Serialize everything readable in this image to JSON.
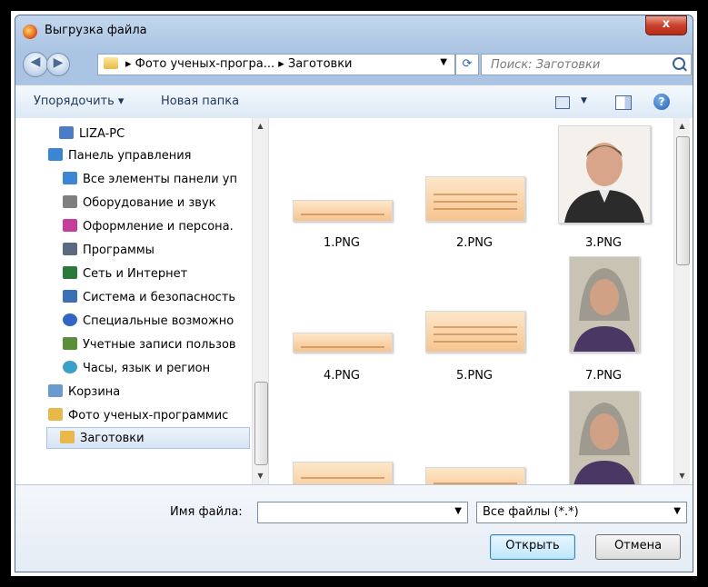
{
  "window": {
    "title": "Выгрузка файла",
    "close_label": "x"
  },
  "address": {
    "path": "▸ Фото ученых-програ... ▸ Заготовки"
  },
  "search": {
    "placeholder": "Поиск: Заготовки"
  },
  "toolbar": {
    "organize_label": "Упорядочить ▾",
    "new_folder_label": "Новая папка"
  },
  "nav": {
    "items": [
      {
        "label": "LIZA-PC",
        "icon": "computer-icon",
        "color": "#4a7cc7"
      },
      {
        "label": "Панель управления",
        "icon": "control-panel-icon",
        "color": "#3a86d4"
      },
      {
        "label": "Все элементы панели уп",
        "icon": "control-panel-icon",
        "color": "#3a86d4"
      },
      {
        "label": "Оборудование и звук",
        "icon": "printer-icon",
        "color": "#7f7f7f"
      },
      {
        "label": "Оформление и персона.",
        "icon": "display-icon",
        "color": "#c63d9b"
      },
      {
        "label": "Программы",
        "icon": "programs-icon",
        "color": "#5a6b80"
      },
      {
        "label": "Сеть и Интернет",
        "icon": "network-icon",
        "color": "#2b7a3b"
      },
      {
        "label": "Система и безопасность",
        "icon": "security-icon",
        "color": "#3b6fb6"
      },
      {
        "label": "Специальные возможно",
        "icon": "accessibility-icon",
        "color": "#2f67c2"
      },
      {
        "label": "Учетные записи пользов",
        "icon": "users-icon",
        "color": "#5a8e3a"
      },
      {
        "label": "Часы, язык и регион",
        "icon": "clock-icon",
        "color": "#3aa0c8"
      },
      {
        "label": "Корзина",
        "icon": "recycle-bin-icon",
        "color": "#6a9bd0"
      },
      {
        "label": "Фото ученых-программис",
        "icon": "folder-icon",
        "color": "#e8b84a"
      },
      {
        "label": "Заготовки",
        "icon": "folder-icon",
        "color": "#e8b84a"
      }
    ]
  },
  "files": [
    {
      "name": "1.PNG",
      "kind": "slide",
      "caption": ""
    },
    {
      "name": "2.PNG",
      "kind": "slide",
      "caption": ""
    },
    {
      "name": "3.PNG",
      "kind": "photo"
    },
    {
      "name": "4.PNG",
      "kind": "slide",
      "caption": ""
    },
    {
      "name": "5.PNG",
      "kind": "slide",
      "caption": ""
    },
    {
      "name": "7.PNG",
      "kind": "photo"
    },
    {
      "name": "",
      "kind": "slide",
      "caption": ""
    },
    {
      "name": "",
      "kind": "slide",
      "caption": ""
    },
    {
      "name": "",
      "kind": "photo"
    }
  ],
  "bottom": {
    "filename_label": "Имя файла:",
    "filename_value": "",
    "filter_value": "Все файлы (*.*)",
    "open_label": "Открыть",
    "cancel_label": "Отмена"
  }
}
